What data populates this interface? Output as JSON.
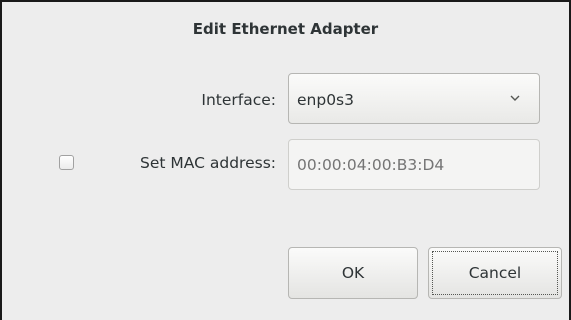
{
  "dialog": {
    "title": "Edit Ethernet Adapter"
  },
  "interface": {
    "label": "Interface:",
    "selected": "enp0s3",
    "dropdown_icon": "chevron-down-icon"
  },
  "mac": {
    "checkbox_checked": false,
    "label": "Set MAC address:",
    "placeholder": "00:00:04:00:B3:D4",
    "value": ""
  },
  "buttons": {
    "ok_label": "OK",
    "cancel_label": "Cancel"
  },
  "colors": {
    "background": "#ededed",
    "text": "#2e3436",
    "placeholder": "#aeb2b3"
  }
}
